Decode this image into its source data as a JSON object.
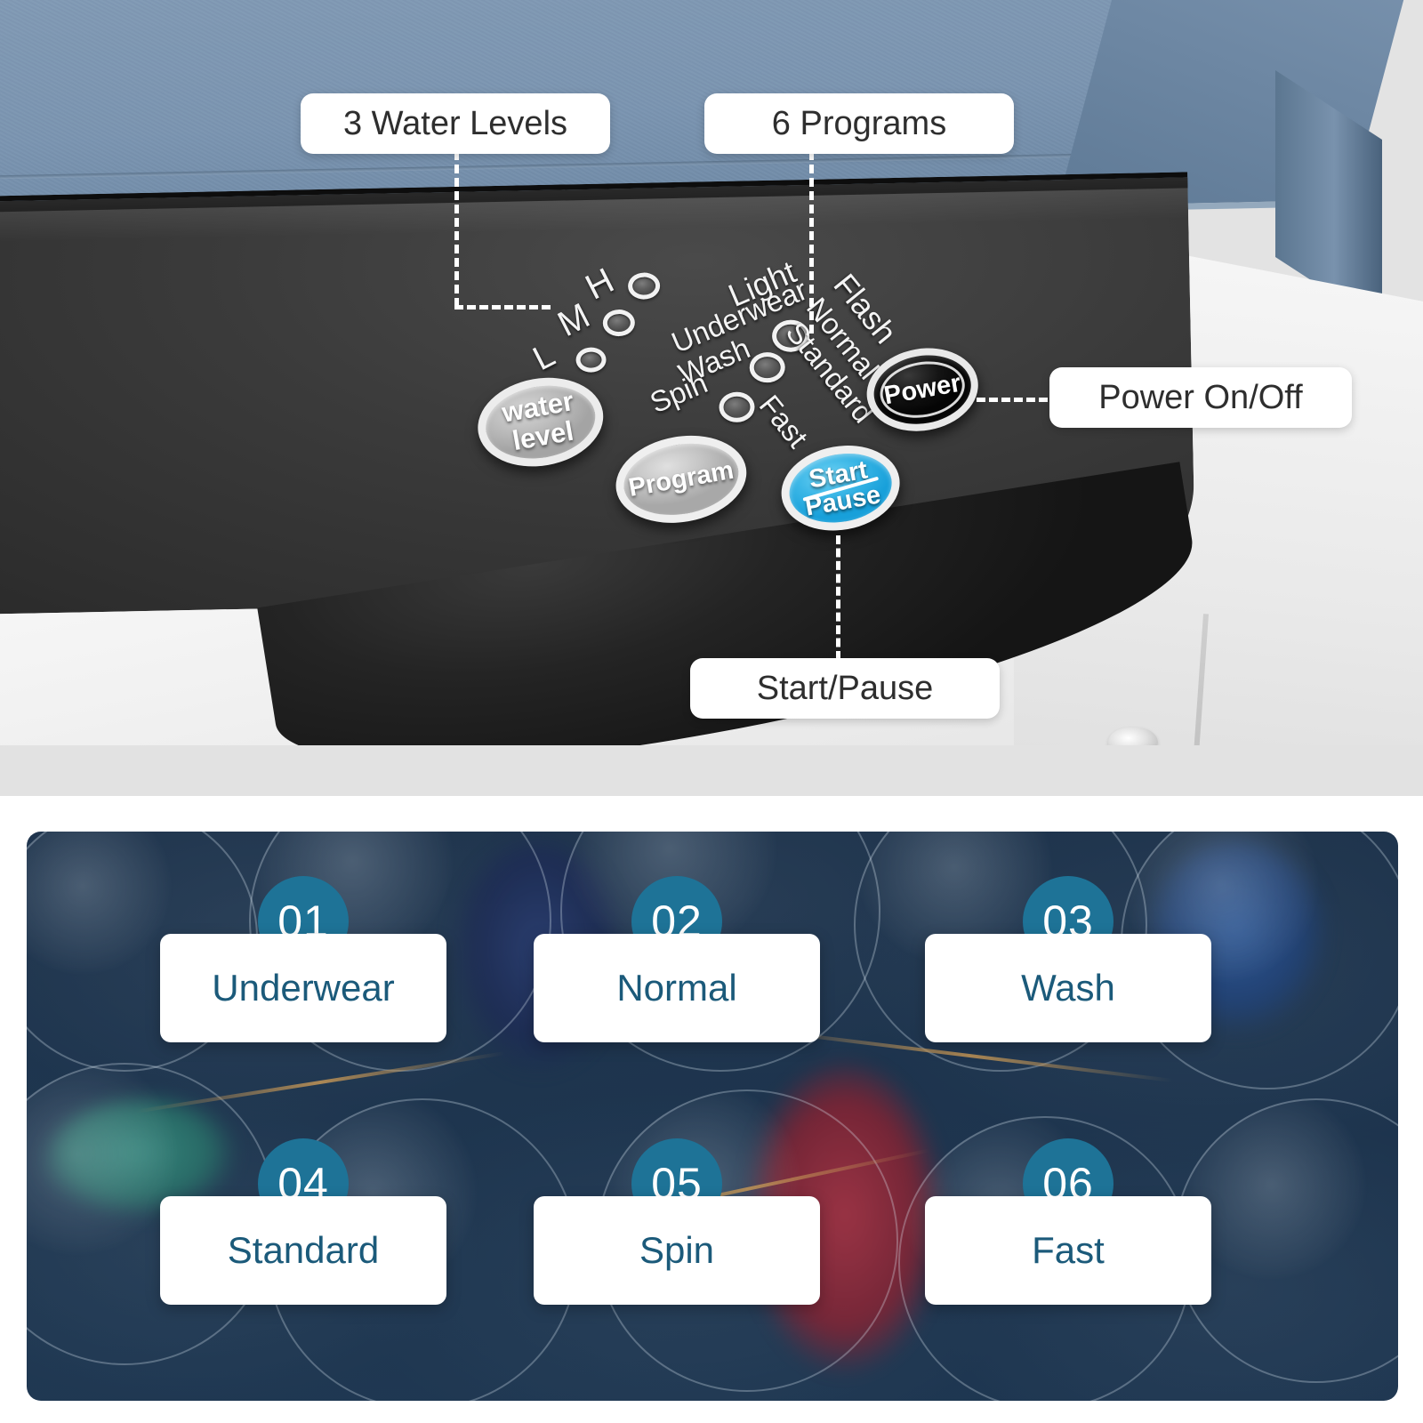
{
  "top_panel": {
    "callouts": [
      {
        "id": "water-levels",
        "label": "3 Water Levels"
      },
      {
        "id": "programs",
        "label": "6 Programs"
      },
      {
        "id": "power",
        "label": "Power On/Off"
      },
      {
        "id": "start-pause",
        "label": "Start/Pause"
      }
    ],
    "control_panel": {
      "water_level_indicators": [
        {
          "label": "H"
        },
        {
          "label": "M"
        },
        {
          "label": "L"
        }
      ],
      "program_labels_upper": [
        "Light",
        "Flash"
      ],
      "program_label_rows": [
        {
          "left": "Underwear",
          "right": "Normal"
        },
        {
          "left": "Wash",
          "right": "Standard"
        },
        {
          "left": "Spin",
          "right": "Fast"
        }
      ],
      "buttons": {
        "water_level_line1": "water",
        "water_level_line2": "level",
        "program": "Program",
        "start_line1": "Start",
        "start_line2": "Pause",
        "power": "Power"
      }
    }
  },
  "bottom_panel": {
    "programs": [
      {
        "number": "01",
        "label": "Underwear"
      },
      {
        "number": "02",
        "label": "Normal"
      },
      {
        "number": "03",
        "label": "Wash"
      },
      {
        "number": "04",
        "label": "Standard"
      },
      {
        "number": "05",
        "label": "Spin"
      },
      {
        "number": "06",
        "label": "Fast"
      }
    ]
  },
  "colors": {
    "badge": "#1e7397",
    "card_text": "#1b5a7a",
    "start_button": "#29abe2",
    "lid": "#7f99b4",
    "console": "#2e2e2e",
    "callout_text": "#2e2e2e"
  }
}
